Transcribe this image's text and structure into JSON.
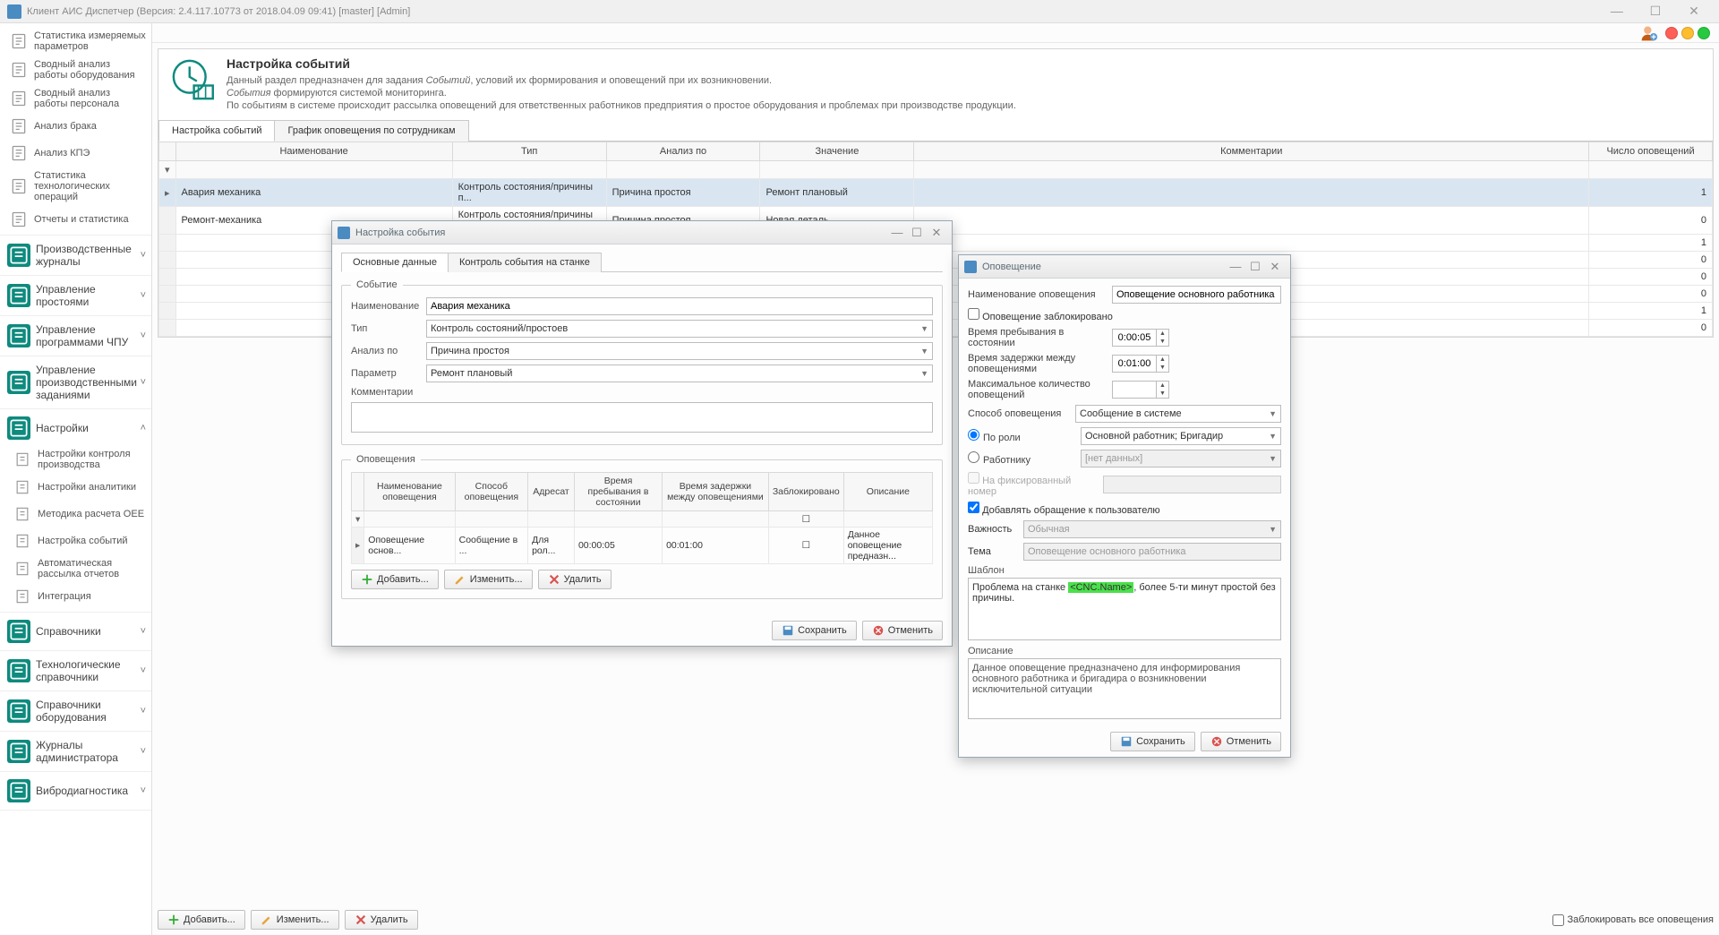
{
  "titlebar": "Клиент АИС Диспетчер (Версия: 2.4.117.10773 от 2018.04.09 09:41)  [master]   [Admin]",
  "sidebar": {
    "top_items": [
      {
        "label": "Статистика измеряемых параметров"
      },
      {
        "label": "Сводный анализ работы оборудования"
      },
      {
        "label": "Сводный анализ работы персонала"
      },
      {
        "label": "Анализ брака"
      },
      {
        "label": "Анализ КПЭ"
      },
      {
        "label": "Статистика технологических операций"
      },
      {
        "label": "Отчеты и статистика"
      }
    ],
    "groups": [
      {
        "label": "Производственные журналы",
        "chev": "˅"
      },
      {
        "label": "Управление простоями",
        "chev": "˅"
      },
      {
        "label": "Управление программами ЧПУ",
        "chev": "˅"
      },
      {
        "label": "Управление производственными заданиями",
        "chev": "˅"
      },
      {
        "label": "Настройки",
        "chev": "˄",
        "open": true,
        "children": [
          {
            "label": "Настройки контроля производства"
          },
          {
            "label": "Настройки аналитики"
          },
          {
            "label": "Методика расчета OEE"
          },
          {
            "label": "Настройка событий"
          },
          {
            "label": "Автоматическая рассылка отчетов"
          },
          {
            "label": "Интеграция"
          }
        ]
      },
      {
        "label": "Справочники",
        "chev": "˅"
      },
      {
        "label": "Технологические справочники",
        "chev": "˅"
      },
      {
        "label": "Справочники оборудования",
        "chev": "˅"
      },
      {
        "label": "Журналы администратора",
        "chev": "˅"
      },
      {
        "label": "Вибродиагностика",
        "chev": "˅"
      }
    ]
  },
  "page": {
    "title": "Настройка событий",
    "desc1_a": "Данный раздел предназначен для задания ",
    "desc1_i": "Событий",
    "desc1_b": ", условий их формирования и оповещений при их возникновении.",
    "desc2_i": "События",
    "desc2_b": " формируются системой мониторинга.",
    "desc3": "По событиям в системе происходит рассылка оповещений для ответственных работников предприятия о простое оборудования и проблемах при производстве продукции."
  },
  "main_tabs": [
    "Настройка событий",
    "График оповещения по сотрудникам"
  ],
  "grid": {
    "headers": [
      "Наименование",
      "Тип",
      "Анализ по",
      "Значение",
      "Комментарии",
      "Число оповещений"
    ],
    "rows": [
      {
        "sel": true,
        "c": [
          "Авария механика",
          "Контроль состояния/причины п...",
          "Причина простоя",
          "Ремонт плановый",
          "",
          "1"
        ]
      },
      {
        "c": [
          "Ремонт-механика",
          "Контроль состояния/причины п...",
          "Причина простоя",
          "Новая деталь",
          "",
          "0"
        ]
      },
      {
        "c": [
          "",
          "",
          "",
          "",
          "",
          "1"
        ]
      },
      {
        "c": [
          "",
          "",
          "",
          "",
          "",
          "0"
        ]
      },
      {
        "c": [
          "",
          "",
          "",
          "",
          "",
          "0"
        ]
      },
      {
        "c": [
          "",
          "",
          "",
          "",
          "",
          "0"
        ]
      },
      {
        "c": [
          "",
          "",
          "",
          "",
          "",
          "1"
        ]
      },
      {
        "c": [
          "",
          "",
          "",
          "",
          "",
          "0"
        ]
      }
    ]
  },
  "bottom_buttons": {
    "add": "Добавить...",
    "edit": "Изменить...",
    "del": "Удалить",
    "block_all": "Заблокировать все оповещения"
  },
  "dlg1": {
    "title": "Настройка события",
    "tabs": [
      "Основные данные",
      "Контроль события на станке"
    ],
    "fs1_legend": "Событие",
    "f_name_label": "Наименование",
    "f_name": "Авария механика",
    "f_type_label": "Тип",
    "f_type": "Контроль состояний/простоев",
    "f_anal_label": "Анализ по",
    "f_anal": "Причина простоя",
    "f_param_label": "Параметр",
    "f_param": "Ремонт плановый",
    "f_comm_label": "Комментарии",
    "f_comm": "",
    "fs2_legend": "Оповещения",
    "inner_grid_headers": [
      "Наименование оповещения",
      "Способ оповещения",
      "Адресат",
      "Время пребывания в состоянии",
      "Время задержки между оповещениями",
      "Заблокировано",
      "Описание"
    ],
    "inner_row": [
      "Оповещение основ...",
      "Сообщение в ...",
      "Для рол...",
      "00:00:05",
      "00:01:00",
      "",
      "Данное оповещение предназн..."
    ],
    "btn_add": "Добавить...",
    "btn_edit": "Изменить...",
    "btn_del": "Удалить",
    "btn_save": "Сохранить",
    "btn_cancel": "Отменить"
  },
  "dlg2": {
    "title": "Оповещение",
    "f_name_label": "Наименование оповещения",
    "f_name": "Оповещение основного работника",
    "chk_blocked": "Оповещение заблокировано",
    "f_stay_label": "Время пребывания в состоянии",
    "f_stay": "0:00:05",
    "f_delay_label": "Время задержки между оповещениями",
    "f_delay": "0:01:00",
    "f_maxcnt_label": "Максимальное количество оповещений",
    "f_maxcnt": "",
    "f_method_label": "Способ оповещения",
    "f_method": "Сообщение в системе",
    "r_role_label": "По роли",
    "r_role_val": "Основной работник; Бригадир",
    "r_worker_label": "Работнику",
    "r_worker_val": "[нет данных]",
    "chk_fixnum": "На фиксированный номер",
    "chk_addappeal": "Добавлять обращение к пользователю",
    "f_imp_label": "Важность",
    "f_imp": "Обычная",
    "f_theme_label": "Тема",
    "f_theme": "Оповещение основного работника",
    "tmpl_label": "Шаблон",
    "tmpl_before": "Проблема на станке ",
    "tmpl_tag": "<CNC.Name>",
    "tmpl_after": ", более 5-ти минут простой без причины.",
    "desc_label": "Описание",
    "desc_text": "Данное оповещение предназначено для информирования основного работника и бригадира о возникновении исключительной ситуации",
    "btn_save": "Сохранить",
    "btn_cancel": "Отменить"
  }
}
